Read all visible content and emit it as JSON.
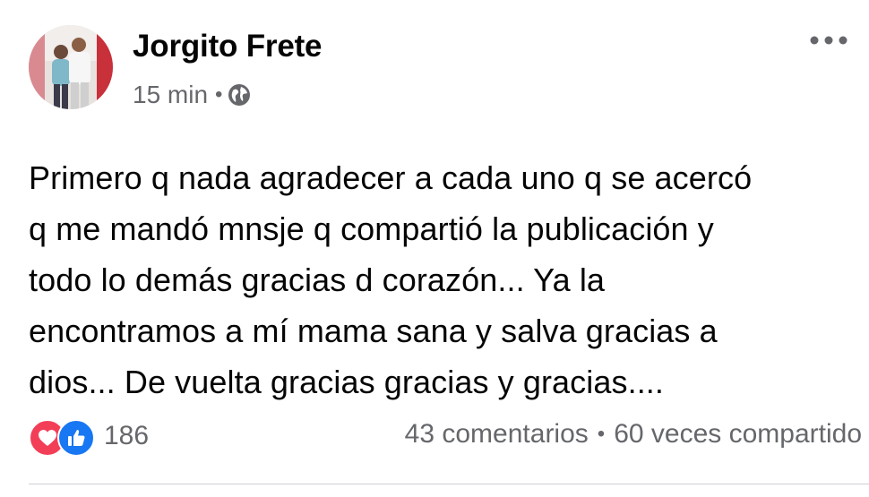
{
  "post": {
    "author": "Jorgito Frete",
    "time": "15 min",
    "meta_separator": "•",
    "privacy_icon": "globe-icon",
    "text": "Primero q nada agradecer a cada uno q se acercó\nq me mandó mnsje q compartió la publicación y\ntodo lo demás gracias d corazón... Ya la\nencontramos a mí mama sana y salva gracias a\ndios... De vuelta gracias gracias y gracias....",
    "reaction_icons": [
      "love-reaction-icon",
      "like-reaction-icon"
    ],
    "reaction_count": "186",
    "comments": "43 comentarios",
    "shares": "60 veces compartido",
    "engagement_separator": "•"
  },
  "colors": {
    "text_primary": "#050505",
    "text_secondary": "#65676b",
    "like_blue": "#1877f2",
    "love_red": "#f33e58",
    "divider": "#ced0d4"
  }
}
